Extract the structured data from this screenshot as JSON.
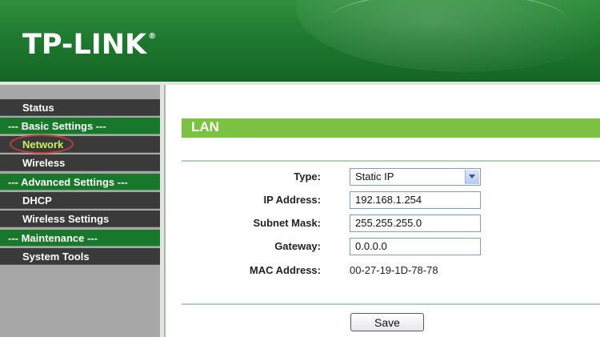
{
  "header": {
    "logo_text": "TP-LINK",
    "logo_mark": "®"
  },
  "sidebar": {
    "items": [
      {
        "label": "Status",
        "kind": "item"
      },
      {
        "label": "--- Basic Settings ---",
        "kind": "group"
      },
      {
        "label": "Network",
        "kind": "item",
        "active": true
      },
      {
        "label": "Wireless",
        "kind": "item"
      },
      {
        "label": "--- Advanced Settings ---",
        "kind": "group"
      },
      {
        "label": "DHCP",
        "kind": "item"
      },
      {
        "label": "Wireless Settings",
        "kind": "item"
      },
      {
        "label": "--- Maintenance ---",
        "kind": "group"
      },
      {
        "label": "System Tools",
        "kind": "item"
      }
    ]
  },
  "main": {
    "section_title": "LAN",
    "fields": {
      "type": {
        "label": "Type:",
        "value": "Static IP"
      },
      "ip": {
        "label": "IP Address:",
        "value": "192.168.1.254"
      },
      "mask": {
        "label": "Subnet Mask:",
        "value": "255.255.255.0"
      },
      "gateway": {
        "label": "Gateway:",
        "value": "0.0.0.0"
      },
      "mac": {
        "label": "MAC Address:",
        "value": "00-27-19-1D-78-78"
      }
    },
    "save_label": "Save"
  },
  "colors": {
    "brand_green": "#1f7a2f",
    "section_green": "#7cc242",
    "active_text": "#c9f25b"
  }
}
